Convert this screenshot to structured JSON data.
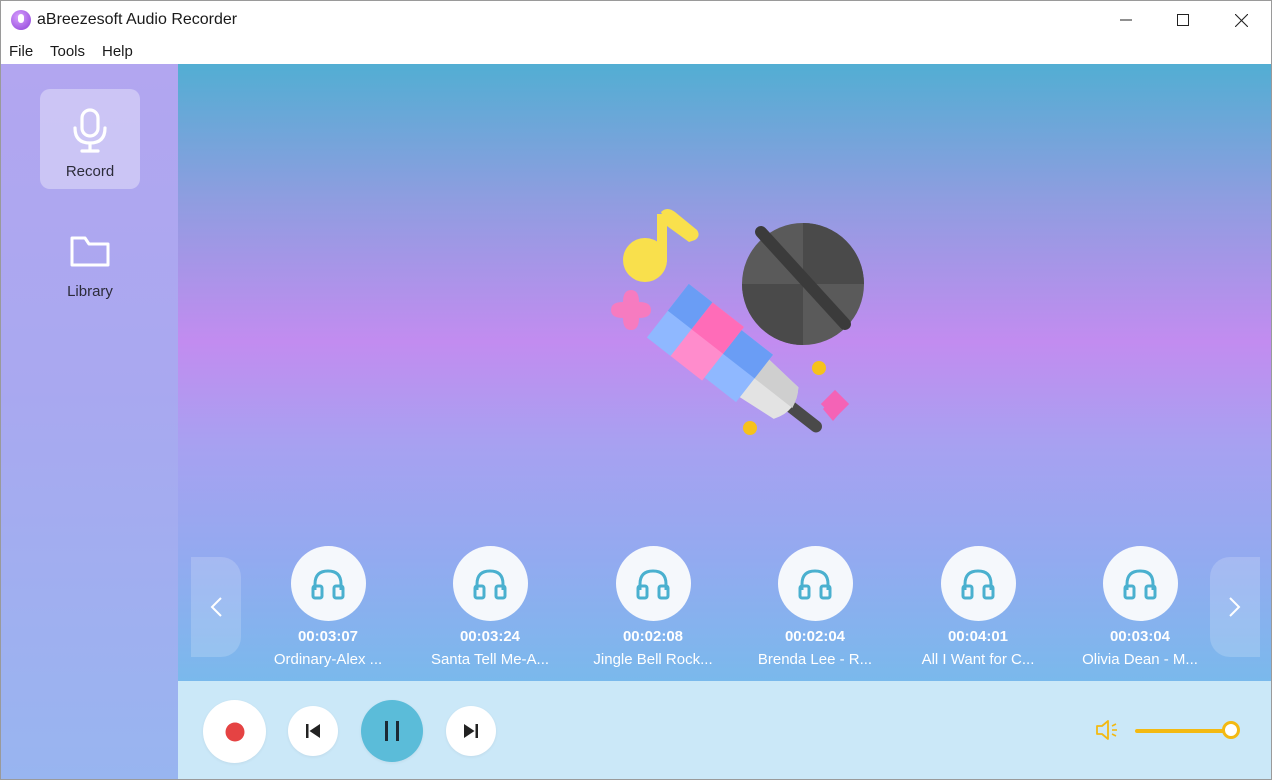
{
  "window": {
    "title": "aBreezesoft Audio Recorder"
  },
  "menu": [
    "File",
    "Tools",
    "Help"
  ],
  "sidebar": {
    "items": [
      {
        "label": "Record",
        "icon": "microphone-icon",
        "active": true
      },
      {
        "label": "Library",
        "icon": "folder-icon",
        "active": false
      }
    ]
  },
  "recordings": [
    {
      "duration": "00:03:07",
      "name": "Ordinary-Alex ..."
    },
    {
      "duration": "00:03:24",
      "name": "Santa Tell Me-A..."
    },
    {
      "duration": "00:02:08",
      "name": "Jingle Bell Rock..."
    },
    {
      "duration": "00:02:04",
      "name": "Brenda Lee - R..."
    },
    {
      "duration": "00:04:01",
      "name": "All I Want for C..."
    },
    {
      "duration": "00:03:04",
      "name": "Olivia Dean - M..."
    }
  ],
  "player": {
    "volume": 0.92
  },
  "colors": {
    "accent": "#5bbcd9",
    "record": "#e54343",
    "volume": "#f3b912"
  }
}
